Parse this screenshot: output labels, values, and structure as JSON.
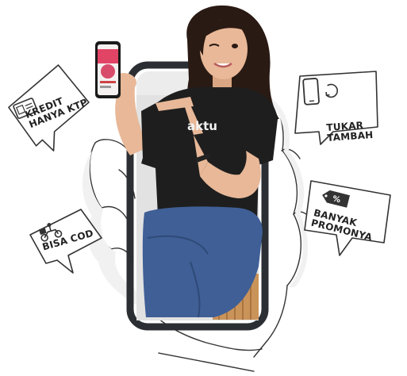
{
  "callouts": {
    "kredit": {
      "line1": "KREDIT",
      "line2": "HANYA KTP",
      "icon": "id-card-icon"
    },
    "cod": {
      "line1": "BISA COD",
      "icon": "delivery-scooter-icon"
    },
    "tukar": {
      "line1": "TUKAR",
      "line2": "TAMBAH",
      "icon": "phone-swap-icon"
    },
    "promo": {
      "line1": "BANYAK",
      "line2": "PROMONYA",
      "icon": "discount-tag-icon"
    }
  },
  "shirt_text": "aktu",
  "colors": {
    "line": "#333333",
    "shirt": "#1e1e1e",
    "jeans": "#3f5f96",
    "skin": "#e8b898",
    "hair": "#2a1a14",
    "phone_frame": "#2b2f33",
    "bench": "#c9935a"
  }
}
